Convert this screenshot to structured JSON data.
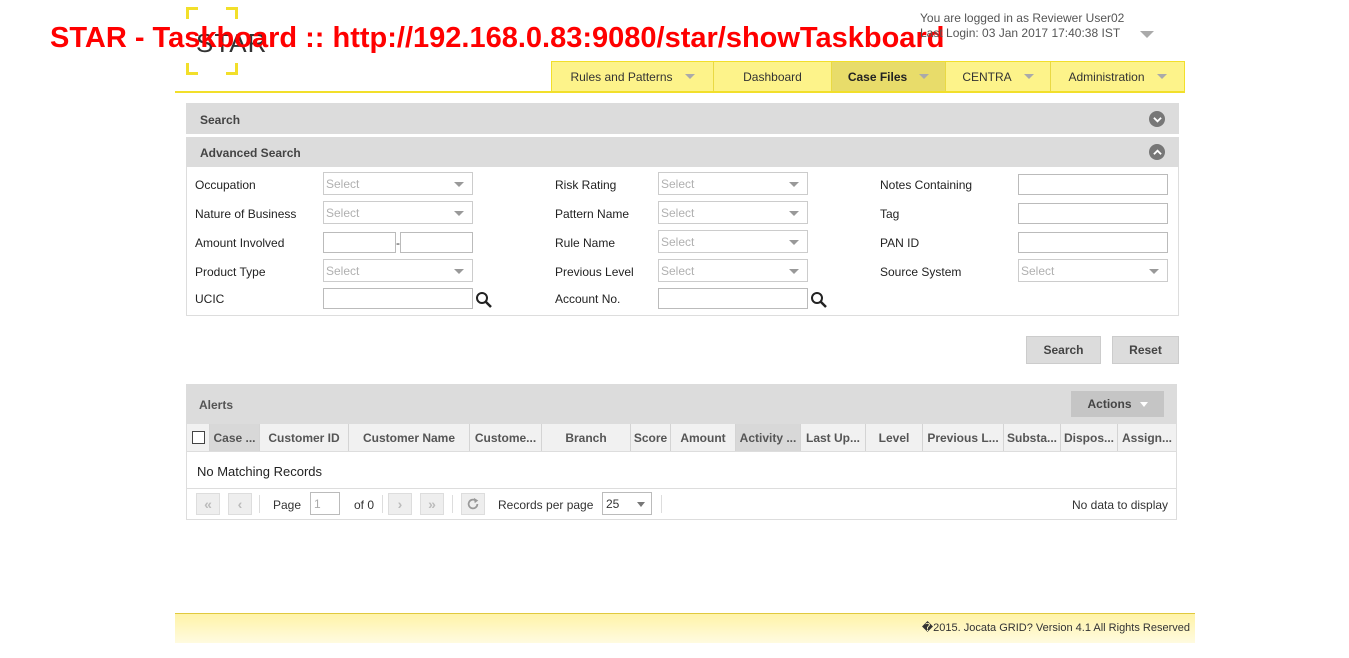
{
  "window": {
    "title": "STAR - Taskboard :: http://192.168.0.83:9080/star/showTaskboard"
  },
  "header": {
    "logo_text": "STAR",
    "user_line": "You are logged in as Reviewer User02",
    "last_login": "Last Login: 03 Jan 2017 17:40:38 IST"
  },
  "nav": {
    "items": [
      {
        "label": "Rules and Patterns",
        "dropdown": true,
        "active": false
      },
      {
        "label": "Dashboard",
        "dropdown": false,
        "active": false
      },
      {
        "label": "Case Files",
        "dropdown": true,
        "active": true
      },
      {
        "label": "CENTRA",
        "dropdown": true,
        "active": false
      },
      {
        "label": "Administration",
        "dropdown": true,
        "active": false
      }
    ]
  },
  "search_panel": {
    "label": "Search",
    "icon": "chevron-down-icon"
  },
  "advanced_search": {
    "label": "Advanced Search",
    "icon": "chevron-up-icon",
    "placeholder": "Select",
    "fields": {
      "occupation": "Occupation",
      "nature_of_business": "Nature of Business",
      "amount_involved": "Amount Involved",
      "product_type": "Product Type",
      "ucic": "UCIC",
      "risk_rating": "Risk Rating",
      "pattern_name": "Pattern Name",
      "rule_name": "Rule Name",
      "previous_level": "Previous Level",
      "account_no": "Account No.",
      "notes_containing": "Notes Containing",
      "tag": "Tag",
      "pan_id": "PAN ID",
      "source_system": "Source System"
    },
    "amount_separator": "-",
    "search_button": "Search",
    "reset_button": "Reset"
  },
  "alerts": {
    "label": "Alerts",
    "actions_label": "Actions",
    "columns": [
      "Case ...",
      "Customer ID",
      "Customer Name",
      "Custome...",
      "Branch",
      "Score",
      "Amount",
      "Activity ...",
      "Last Up...",
      "Level",
      "Previous L...",
      "Substa...",
      "Dispos...",
      "Assign..."
    ],
    "empty_message": "No Matching Records",
    "pager": {
      "first": "«",
      "prev": "‹",
      "next": "›",
      "last": "»",
      "page_label": "Page",
      "page_value": "1",
      "of_label": "of 0",
      "records_per_page_label": "Records per page",
      "records_per_page_value": "25",
      "status": "No data to display"
    }
  },
  "footer": {
    "text": "�2015. Jocata GRID? Version 4.1 All Rights Reserved"
  },
  "colors": {
    "brand_yellow": "#f2df2a",
    "nav_bg": "#fdf38a",
    "title_red": "#ff0000",
    "panel_gray": "#dcdcdc"
  }
}
